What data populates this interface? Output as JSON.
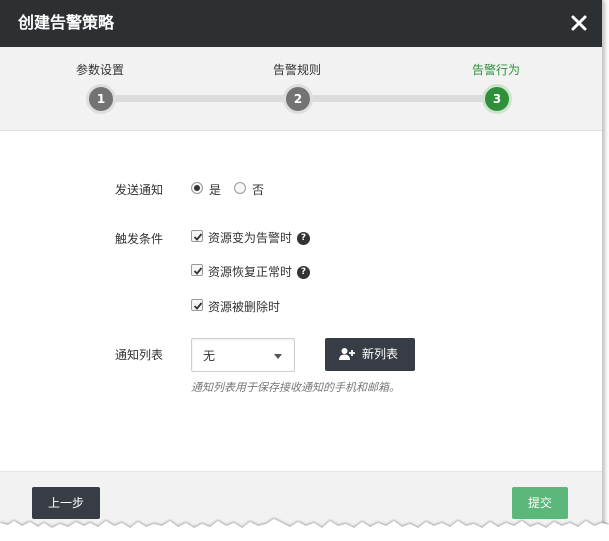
{
  "dialog": {
    "title": "创建告警策略",
    "close_icon": "close-icon"
  },
  "steps": [
    {
      "label": "参数设置",
      "number": "1",
      "active": false
    },
    {
      "label": "告警规则",
      "number": "2",
      "active": false
    },
    {
      "label": "告警行为",
      "number": "3",
      "active": true
    }
  ],
  "form": {
    "send_notify": {
      "label": "发送通知",
      "options": [
        {
          "label": "是",
          "checked": true
        },
        {
          "label": "否",
          "checked": false
        }
      ]
    },
    "trigger": {
      "label": "触发条件",
      "options": [
        {
          "label": "资源变为告警时",
          "checked": true,
          "help": "?"
        },
        {
          "label": "资源恢复正常时",
          "checked": true,
          "help": "?"
        },
        {
          "label": "资源被删除时",
          "checked": true
        }
      ]
    },
    "notify_list": {
      "label": "通知列表",
      "selected": "无",
      "new_button": "新列表",
      "new_button_icon": "add-user-icon",
      "hint": "通知列表用于保存接收通知的手机和邮箱。"
    }
  },
  "footer": {
    "prev_label": "上一步",
    "submit_label": "提交"
  },
  "colors": {
    "titlebar": "#2c3033",
    "active_step": "#2f8f3b",
    "dark_button": "#383c44",
    "submit_button": "#5cb87a"
  }
}
